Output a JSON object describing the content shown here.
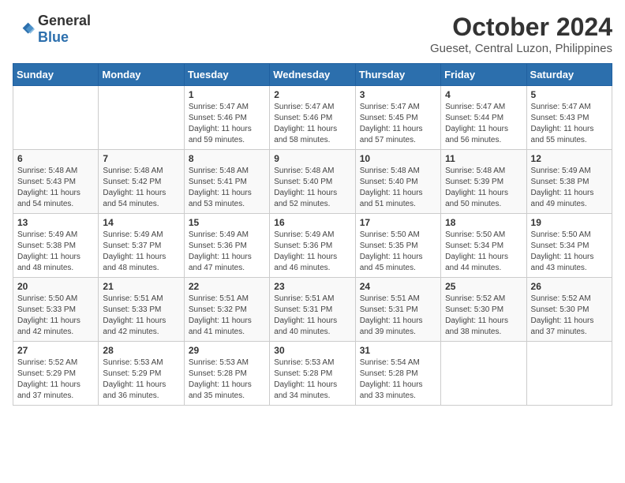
{
  "header": {
    "logo_general": "General",
    "logo_blue": "Blue",
    "month_title": "October 2024",
    "location": "Gueset, Central Luzon, Philippines"
  },
  "weekdays": [
    "Sunday",
    "Monday",
    "Tuesday",
    "Wednesday",
    "Thursday",
    "Friday",
    "Saturday"
  ],
  "weeks": [
    [
      {
        "day": "",
        "info": ""
      },
      {
        "day": "",
        "info": ""
      },
      {
        "day": "1",
        "info": "Sunrise: 5:47 AM\nSunset: 5:46 PM\nDaylight: 11 hours and 59 minutes."
      },
      {
        "day": "2",
        "info": "Sunrise: 5:47 AM\nSunset: 5:46 PM\nDaylight: 11 hours and 58 minutes."
      },
      {
        "day": "3",
        "info": "Sunrise: 5:47 AM\nSunset: 5:45 PM\nDaylight: 11 hours and 57 minutes."
      },
      {
        "day": "4",
        "info": "Sunrise: 5:47 AM\nSunset: 5:44 PM\nDaylight: 11 hours and 56 minutes."
      },
      {
        "day": "5",
        "info": "Sunrise: 5:47 AM\nSunset: 5:43 PM\nDaylight: 11 hours and 55 minutes."
      }
    ],
    [
      {
        "day": "6",
        "info": "Sunrise: 5:48 AM\nSunset: 5:43 PM\nDaylight: 11 hours and 54 minutes."
      },
      {
        "day": "7",
        "info": "Sunrise: 5:48 AM\nSunset: 5:42 PM\nDaylight: 11 hours and 54 minutes."
      },
      {
        "day": "8",
        "info": "Sunrise: 5:48 AM\nSunset: 5:41 PM\nDaylight: 11 hours and 53 minutes."
      },
      {
        "day": "9",
        "info": "Sunrise: 5:48 AM\nSunset: 5:40 PM\nDaylight: 11 hours and 52 minutes."
      },
      {
        "day": "10",
        "info": "Sunrise: 5:48 AM\nSunset: 5:40 PM\nDaylight: 11 hours and 51 minutes."
      },
      {
        "day": "11",
        "info": "Sunrise: 5:48 AM\nSunset: 5:39 PM\nDaylight: 11 hours and 50 minutes."
      },
      {
        "day": "12",
        "info": "Sunrise: 5:49 AM\nSunset: 5:38 PM\nDaylight: 11 hours and 49 minutes."
      }
    ],
    [
      {
        "day": "13",
        "info": "Sunrise: 5:49 AM\nSunset: 5:38 PM\nDaylight: 11 hours and 48 minutes."
      },
      {
        "day": "14",
        "info": "Sunrise: 5:49 AM\nSunset: 5:37 PM\nDaylight: 11 hours and 48 minutes."
      },
      {
        "day": "15",
        "info": "Sunrise: 5:49 AM\nSunset: 5:36 PM\nDaylight: 11 hours and 47 minutes."
      },
      {
        "day": "16",
        "info": "Sunrise: 5:49 AM\nSunset: 5:36 PM\nDaylight: 11 hours and 46 minutes."
      },
      {
        "day": "17",
        "info": "Sunrise: 5:50 AM\nSunset: 5:35 PM\nDaylight: 11 hours and 45 minutes."
      },
      {
        "day": "18",
        "info": "Sunrise: 5:50 AM\nSunset: 5:34 PM\nDaylight: 11 hours and 44 minutes."
      },
      {
        "day": "19",
        "info": "Sunrise: 5:50 AM\nSunset: 5:34 PM\nDaylight: 11 hours and 43 minutes."
      }
    ],
    [
      {
        "day": "20",
        "info": "Sunrise: 5:50 AM\nSunset: 5:33 PM\nDaylight: 11 hours and 42 minutes."
      },
      {
        "day": "21",
        "info": "Sunrise: 5:51 AM\nSunset: 5:33 PM\nDaylight: 11 hours and 42 minutes."
      },
      {
        "day": "22",
        "info": "Sunrise: 5:51 AM\nSunset: 5:32 PM\nDaylight: 11 hours and 41 minutes."
      },
      {
        "day": "23",
        "info": "Sunrise: 5:51 AM\nSunset: 5:31 PM\nDaylight: 11 hours and 40 minutes."
      },
      {
        "day": "24",
        "info": "Sunrise: 5:51 AM\nSunset: 5:31 PM\nDaylight: 11 hours and 39 minutes."
      },
      {
        "day": "25",
        "info": "Sunrise: 5:52 AM\nSunset: 5:30 PM\nDaylight: 11 hours and 38 minutes."
      },
      {
        "day": "26",
        "info": "Sunrise: 5:52 AM\nSunset: 5:30 PM\nDaylight: 11 hours and 37 minutes."
      }
    ],
    [
      {
        "day": "27",
        "info": "Sunrise: 5:52 AM\nSunset: 5:29 PM\nDaylight: 11 hours and 37 minutes."
      },
      {
        "day": "28",
        "info": "Sunrise: 5:53 AM\nSunset: 5:29 PM\nDaylight: 11 hours and 36 minutes."
      },
      {
        "day": "29",
        "info": "Sunrise: 5:53 AM\nSunset: 5:28 PM\nDaylight: 11 hours and 35 minutes."
      },
      {
        "day": "30",
        "info": "Sunrise: 5:53 AM\nSunset: 5:28 PM\nDaylight: 11 hours and 34 minutes."
      },
      {
        "day": "31",
        "info": "Sunrise: 5:54 AM\nSunset: 5:28 PM\nDaylight: 11 hours and 33 minutes."
      },
      {
        "day": "",
        "info": ""
      },
      {
        "day": "",
        "info": ""
      }
    ]
  ]
}
